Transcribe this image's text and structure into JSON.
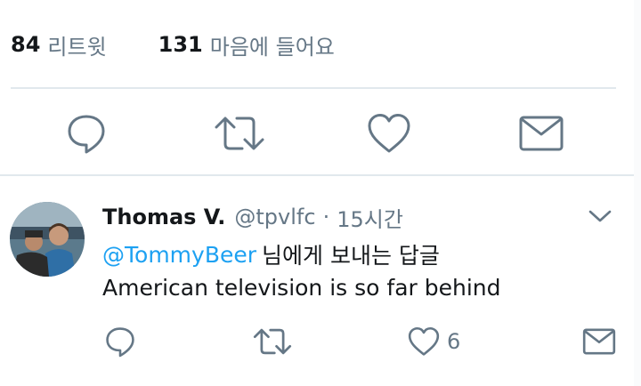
{
  "stats": {
    "retweets_count": "84",
    "retweets_label": "리트윗",
    "likes_count": "131",
    "likes_label": "마음에 들어요"
  },
  "main_actions": {
    "icons": [
      "reply-icon",
      "retweet-icon",
      "like-icon",
      "message-icon"
    ]
  },
  "reply": {
    "display_name": "Thomas V.",
    "handle": "@tpvlfc",
    "separator": "·",
    "time": "15시간",
    "mention": "@TommyBeer",
    "reply_suffix": "님에게 보내는 답글",
    "text": "American television is so far behind",
    "like_count": "6"
  },
  "colors": {
    "text": "#14171a",
    "secondary": "#657786",
    "accent": "#1da1f2",
    "divider": "#e1e8ed"
  }
}
